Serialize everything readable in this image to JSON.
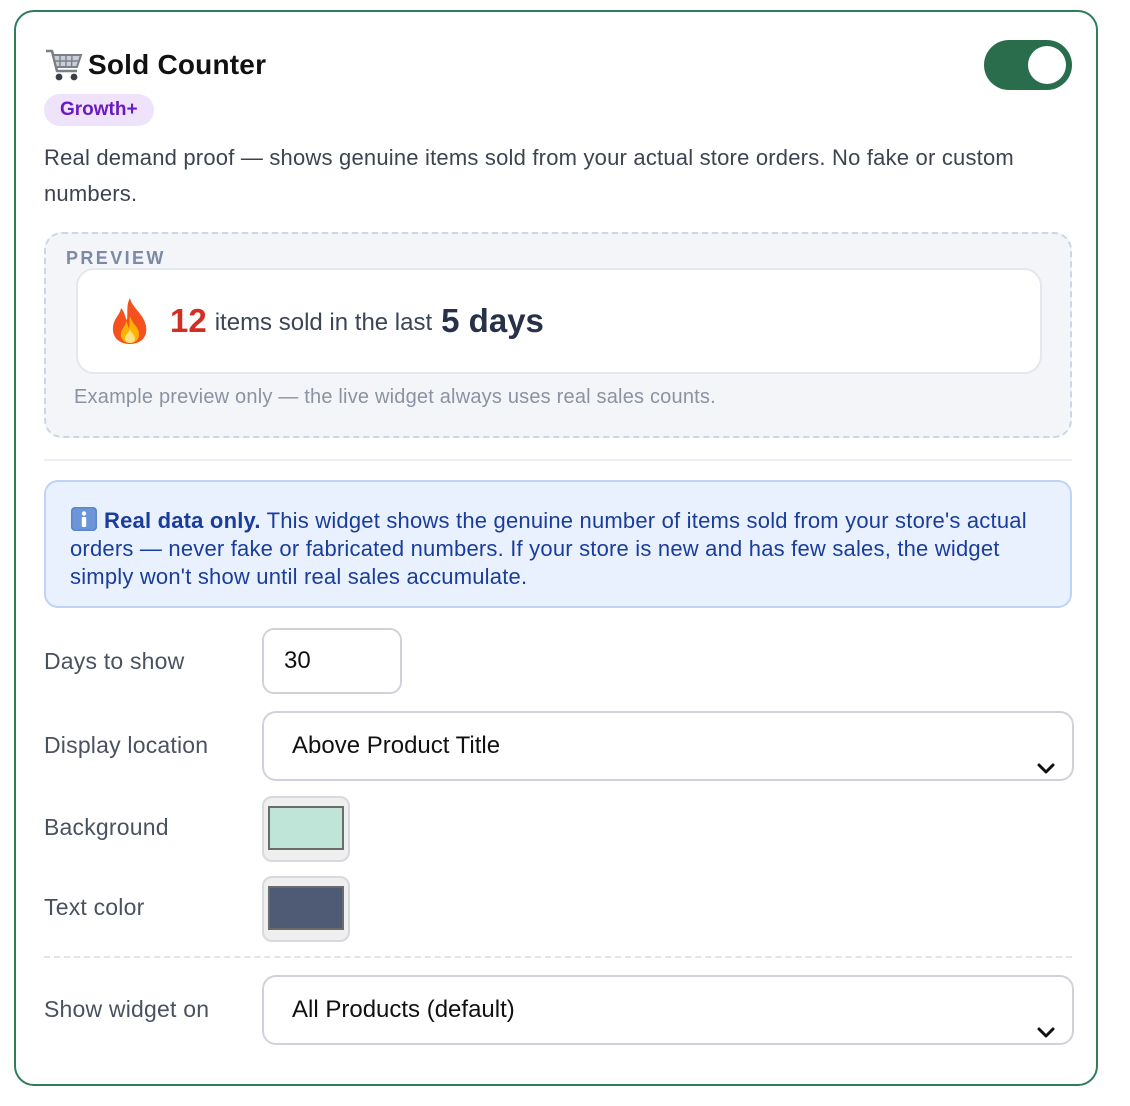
{
  "widget": {
    "title": "Sold Counter",
    "title_icon": "shopping-cart-icon",
    "badge": "Growth+",
    "enabled": true,
    "description": "Real demand proof — shows genuine items sold from your actual store orders. No fake or custom numbers."
  },
  "preview": {
    "label": "PREVIEW",
    "icon": "fire-icon",
    "count": "12",
    "text": "items sold in the last",
    "days": "5 days",
    "note": "Example preview only — the live widget always uses real sales counts."
  },
  "info": {
    "icon": "info-icon",
    "strong": "Real data only.",
    "text": "This widget shows the genuine number of items sold from your store's actual orders — never fake or fabricated numbers. If your store is new and has few sales, the widget simply won't show until real sales accumulate."
  },
  "form": {
    "days_label": "Days to show",
    "days_value": "30",
    "location_label": "Display location",
    "location_value": "Above Product Title",
    "background_label": "Background",
    "background_color": "#bfe4d8",
    "text_color_label": "Text color",
    "text_color": "#4f5b74",
    "show_on_label": "Show widget on",
    "show_on_value": "All Products (default)"
  },
  "colors": {
    "card_border": "#2f7d5b",
    "toggle_on": "#2a6d4d",
    "badge_bg": "#efe2fb",
    "badge_text": "#6a1bbf",
    "count_red": "#d12f22",
    "info_text": "#1a3d9c"
  }
}
